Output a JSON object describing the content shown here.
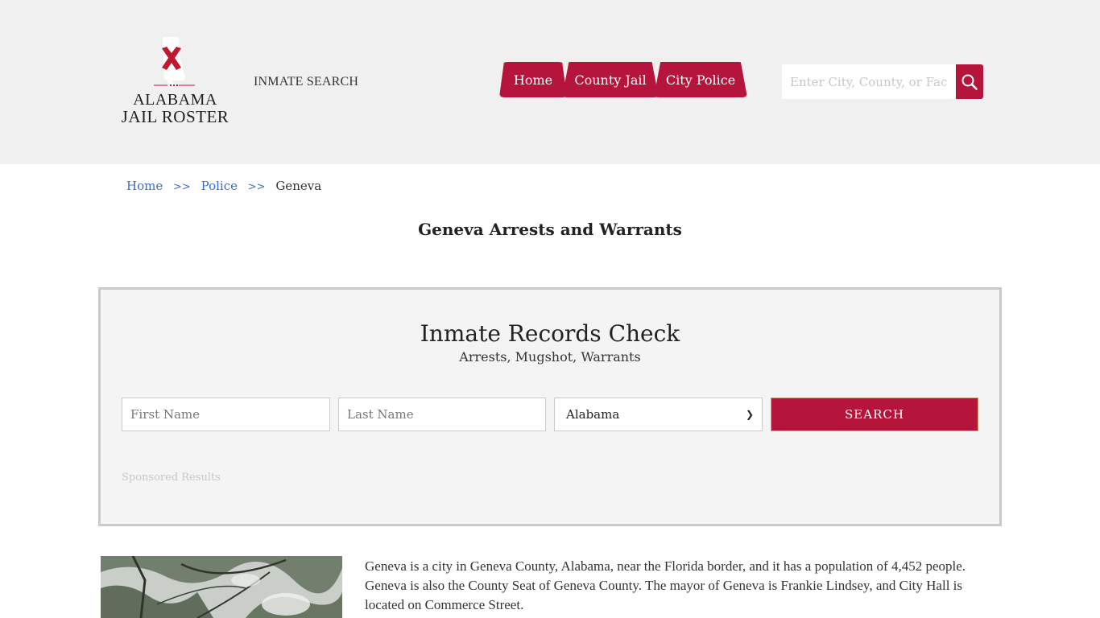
{
  "header": {
    "logo": {
      "line1": "ALABAMA",
      "line2": "JAIL ROSTER",
      "icon": "alabama-state-flag-icon"
    },
    "inmate_search_label": "INMATE SEARCH",
    "nav": [
      {
        "label": "Home"
      },
      {
        "label": "County Jail"
      },
      {
        "label": "City Police"
      }
    ],
    "search": {
      "placeholder": "Enter City, County, or Facility",
      "icon": "search-icon"
    }
  },
  "breadcrumb": {
    "items": [
      {
        "label": "Home"
      },
      {
        "label": "Police"
      }
    ],
    "separator": ">>",
    "current": "Geneva"
  },
  "page_title": "Geneva Arrests and Warrants",
  "records": {
    "title": "Inmate Records Check",
    "subtitle": "Arrests, Mugshot, Warrants",
    "first_name_placeholder": "First Name",
    "last_name_placeholder": "Last Name",
    "state_selected": "Alabama",
    "search_label": "SEARCH",
    "sponsored_label": "Sponsored Results"
  },
  "content": {
    "photo_alt": "Trees in Geneva",
    "description": "Geneva is a city in Geneva County, Alabama, near the Florida border, and it has a population of 4,452 people. Geneva is also the County Seat of Geneva County. The mayor of Geneva is Frankie Lindsey, and City Hall is located on Commerce Street."
  },
  "colors": {
    "accent": "#b5153b",
    "link": "#3c6bc9",
    "header_bg": "#f0f0f0",
    "box_bg": "#f4f4f4"
  }
}
